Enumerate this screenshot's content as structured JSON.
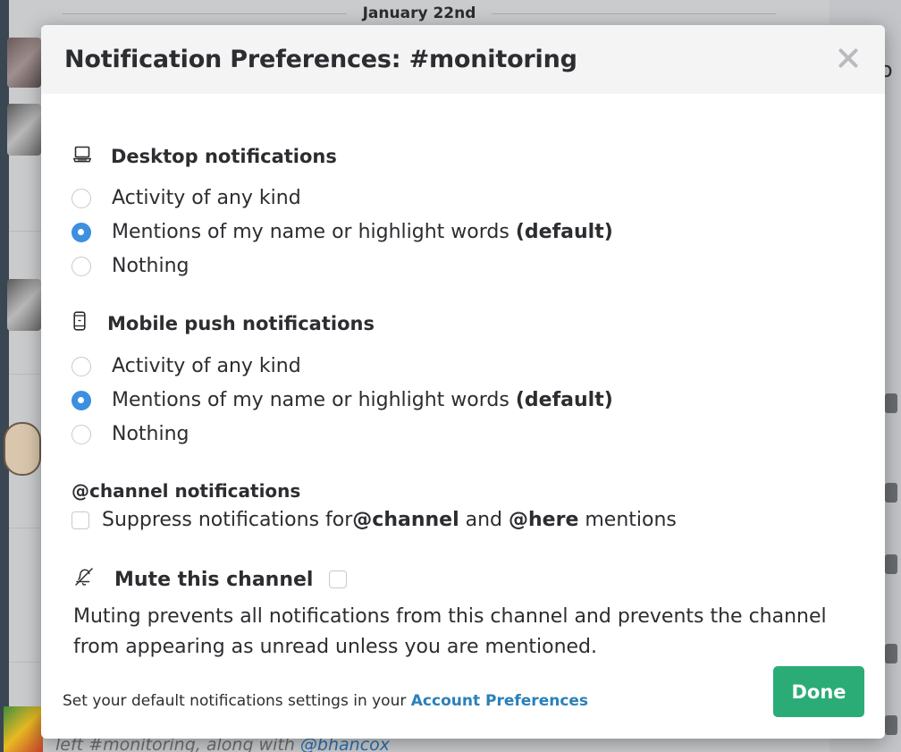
{
  "background": {
    "date_divider": "January 22nd",
    "right_peek_text": "o",
    "bottom_message": {
      "prefix": "left #monitoring, along with ",
      "mention": "@bhancox"
    }
  },
  "modal": {
    "title": "Notification Preferences: #monitoring",
    "close_icon": "close-icon",
    "desktop": {
      "icon": "laptop-icon",
      "heading": "Desktop notifications",
      "options": [
        {
          "label": "Activity of any kind",
          "suffix": "",
          "checked": false
        },
        {
          "label": "Mentions of my name or highlight words",
          "suffix": "(default)",
          "checked": true
        },
        {
          "label": "Nothing",
          "suffix": "",
          "checked": false
        }
      ]
    },
    "mobile": {
      "icon": "mobile-phone-icon",
      "heading": "Mobile push notifications",
      "options": [
        {
          "label": "Activity of any kind",
          "suffix": "",
          "checked": false
        },
        {
          "label": "Mentions of my name or highlight words",
          "suffix": "(default)",
          "checked": true
        },
        {
          "label": "Nothing",
          "suffix": "",
          "checked": false
        }
      ]
    },
    "channel": {
      "heading": "@channel notifications",
      "suppress": {
        "part1": "Suppress notifications for ",
        "channel": "@channel",
        "part2": " and ",
        "here": "@here",
        "part3": " mentions",
        "checked": false
      }
    },
    "mute": {
      "icon": "bell-off-icon",
      "label": "Mute this channel",
      "checked": false,
      "description": "Muting prevents all notifications from this channel and prevents the channel from appearing as unread unless you are mentioned."
    },
    "footer": {
      "text": "Set your default notifications settings in your ",
      "link": "Account Preferences",
      "done_label": "Done"
    },
    "colors": {
      "accent_blue": "#3d8fe0",
      "done_green": "#2bac76",
      "link_blue": "#2a80b9"
    }
  }
}
